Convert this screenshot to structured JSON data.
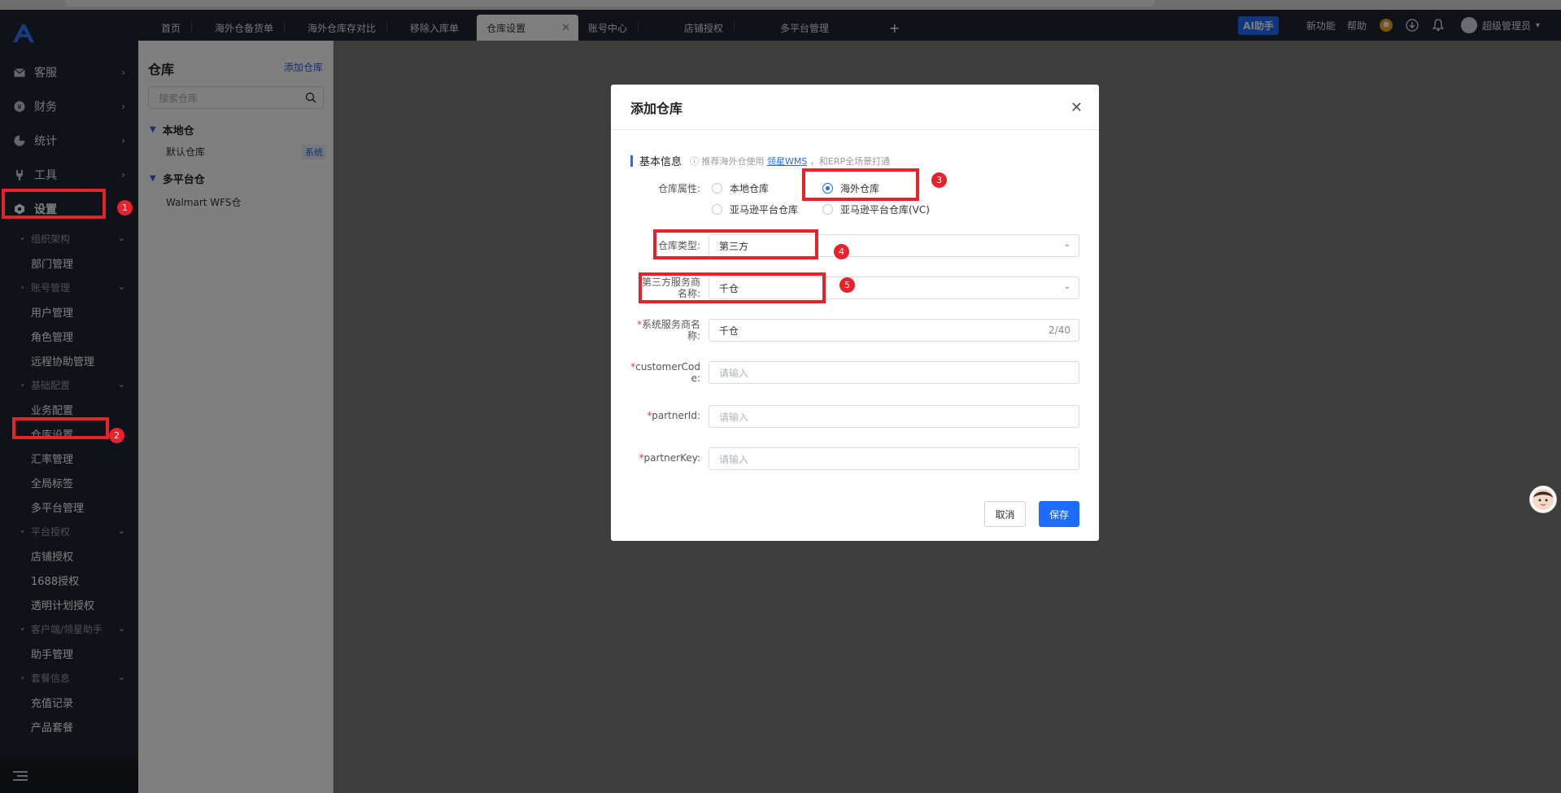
{
  "sidebar": {
    "main": [
      {
        "label": "客服",
        "icon": "mail-icon"
      },
      {
        "label": "财务",
        "icon": "yen-icon"
      },
      {
        "label": "统计",
        "icon": "pie-chart-icon"
      },
      {
        "label": "工具",
        "icon": "wrench-icon"
      },
      {
        "label": "设置",
        "icon": "settings-hex-icon"
      }
    ],
    "groups": [
      {
        "title": "组织架构",
        "items": [
          "部门管理"
        ]
      },
      {
        "title": "账号管理",
        "items": [
          "用户管理",
          "角色管理",
          "远程协助管理"
        ]
      },
      {
        "title": "基础配置",
        "items": [
          "业务配置",
          "仓库设置",
          "汇率管理",
          "全局标签",
          "多平台管理"
        ]
      },
      {
        "title": "平台授权",
        "items": [
          "店铺授权",
          "1688授权",
          "透明计划授权"
        ]
      },
      {
        "title": "客户端/领星助手",
        "items": [
          "助手管理"
        ]
      },
      {
        "title": "套餐信息",
        "items": [
          "充值记录",
          "产品套餐"
        ]
      }
    ]
  },
  "tabs": [
    "首页",
    "海外仓备货单",
    "海外仓库存对比",
    "移除入库单",
    "仓库设置",
    "账号中心",
    "店铺授权",
    "多平台管理"
  ],
  "topbar": {
    "ai": "AI助手",
    "new_features": "新功能",
    "help": "帮助",
    "user": "超级管理员"
  },
  "warehouse_panel": {
    "title": "仓库",
    "add": "添加仓库",
    "search_placeholder": "搜索仓库",
    "groups": [
      {
        "name": "本地仓",
        "items": [
          {
            "name": "默认仓库",
            "badge": "系统"
          }
        ]
      },
      {
        "name": "多平台仓",
        "items": [
          {
            "name": "Walmart WFS仓",
            "badge": ""
          }
        ]
      }
    ]
  },
  "modal": {
    "title": "添加仓库",
    "section": "基本信息",
    "hint_pre": "ⓘ 推荐海外仓使用",
    "hint_link": "领星WMS",
    "hint_post": "，和ERP全场景打通",
    "attr_label": "仓库属性:",
    "radios": [
      "本地仓库",
      "海外仓库",
      "亚马逊平台仓库",
      "亚马逊平台仓库(VC)"
    ],
    "type_label": "仓库类型:",
    "type_value": "第三方",
    "provider_label_1": "第三方服务商",
    "provider_label_2": "名称:",
    "provider_value": "千仓",
    "sys_label_1": "系统服务商名",
    "sys_label_2": "称:",
    "sys_value": "千仓",
    "sys_count": "2/40",
    "cust_label_1": "customerCod",
    "cust_label_2": "e:",
    "partner_id_label": "partnerId:",
    "partner_key_label": "partnerKey:",
    "placeholder": "请输入",
    "cancel": "取消",
    "save": "保存"
  },
  "markers": [
    "1",
    "2",
    "3",
    "4",
    "5"
  ],
  "colors": {
    "accent": "#1e6cff",
    "annotation": "#e8212b",
    "sidebar_bg": "#1f2430"
  }
}
